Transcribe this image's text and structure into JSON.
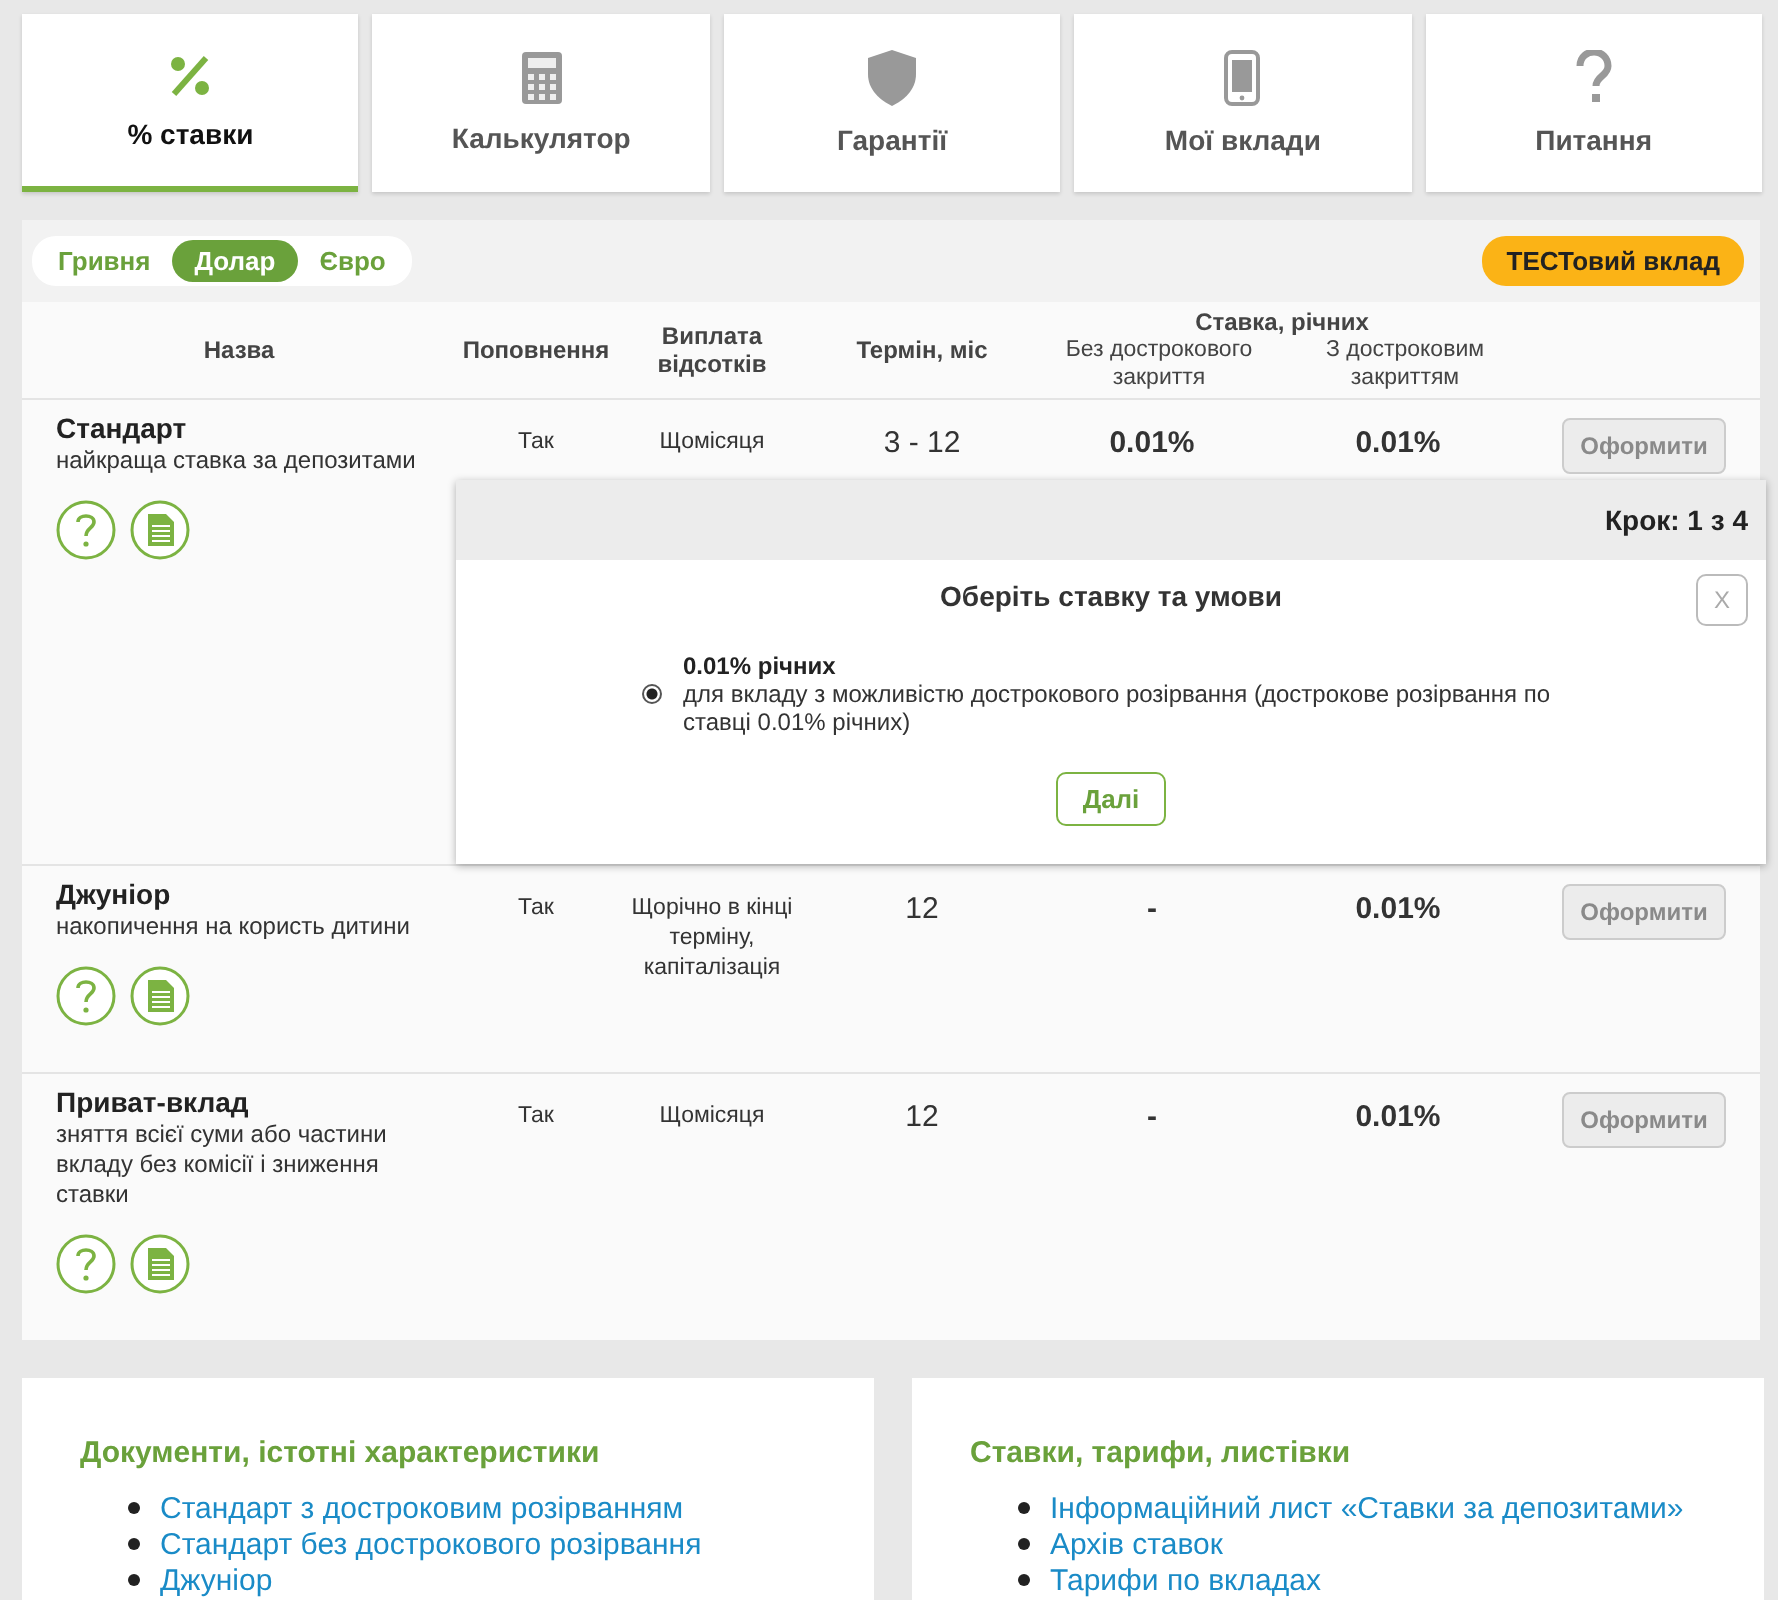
{
  "tabs": [
    {
      "label": "% ставки",
      "kind": "percent",
      "selected": true
    },
    {
      "label": "Калькулятор",
      "kind": "calculator",
      "selected": false
    },
    {
      "label": "Гарантії",
      "kind": "guarantees",
      "selected": false
    },
    {
      "label": "Мої вклади",
      "kind": "mobile",
      "selected": false
    },
    {
      "label": "Питання",
      "kind": "faq",
      "selected": false
    }
  ],
  "currencies": [
    {
      "label": "Гривня",
      "selected": false
    },
    {
      "label": "Долар",
      "selected": true
    },
    {
      "label": "Євро",
      "selected": false
    }
  ],
  "test_button": "ТЕСТовий вклад",
  "table": {
    "columns": {
      "name": "Назва",
      "replenishment": "Поповнення",
      "payout": "Виплата відсотків",
      "term": "Термін, міс",
      "rate_group": "Ставка, річних",
      "rate_no_early": "Без дострокового закриття",
      "rate_early": "З достроковим закриттям"
    },
    "rows": [
      {
        "name": "Стандарт",
        "description": "найкраща ставка за депозитами",
        "replenishment": "Так",
        "payout": "Щомісяця",
        "term": "3 - 12",
        "rate_no_early": "0.01%",
        "rate_early": "0.01%",
        "action": "Оформити",
        "disabled": true,
        "expanded": true
      },
      {
        "name": "Джуніор",
        "description": "накопичення на користь дитини",
        "replenishment": "Так",
        "payout": "Щорічно в кінці терміну, капіталізація",
        "term": "12",
        "rate_no_early": "-",
        "rate_early": "0.01%",
        "action": "Оформити",
        "disabled": true,
        "expanded": false
      },
      {
        "name": "Приват-вклад",
        "description": "зняття всієї суми або частини вкладу без комісії і зниження ставки",
        "replenishment": "Так",
        "payout": "Щомісяця",
        "term": "12",
        "rate_no_early": "-",
        "rate_early": "0.01%",
        "action": "Оформити",
        "disabled": true,
        "expanded": false
      }
    ]
  },
  "popup": {
    "step": "Крок: 1 з 4",
    "title": "Оберіть ставку та умови",
    "close": "X",
    "options": [
      {
        "title": "0.01% річних",
        "description": "для вкладу з можливістю дострокового розірвання (дострокове розірвання по ставці 0.01% річних)",
        "selected": true
      }
    ],
    "next": "Далі"
  },
  "panels": [
    {
      "title": "Документи, істотні характеристики",
      "links": [
        "Стандарт з достроковим розірванням",
        "Стандарт без дострокового розірвання",
        "Джуніор"
      ]
    },
    {
      "title": "Ставки, тарифи, листівки",
      "links": [
        "Інформаційний лист «Ставки за депозитами»",
        "Архів ставок",
        "Тарифи по вкладах"
      ]
    }
  ]
}
